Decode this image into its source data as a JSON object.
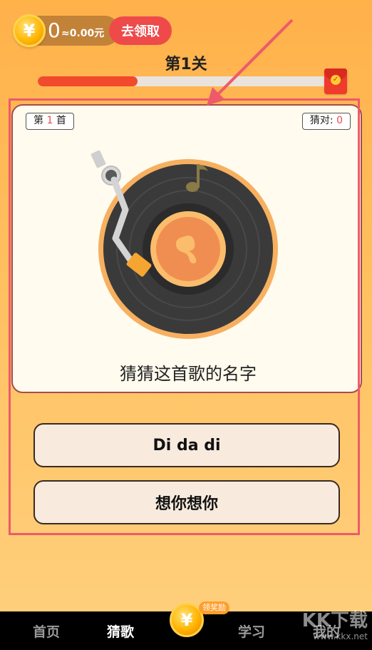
{
  "header": {
    "coin_symbol": "¥",
    "coin_count": "0",
    "money_value": "≈0.00元",
    "claim_label": "去领取"
  },
  "level": {
    "title": "第1关",
    "progress_fraction": 0.34
  },
  "card": {
    "song_prefix": "第",
    "song_number": "1",
    "song_suffix": "首",
    "correct_label": "猜对:",
    "correct_count": "0",
    "question": "猜猜这首歌的名字"
  },
  "options": [
    {
      "label": "Di da di"
    },
    {
      "label": "想你想你"
    }
  ],
  "nav": {
    "home": "首页",
    "guess": "猜歌",
    "center_symbol": "¥",
    "center_badge": "领奖励",
    "learn": "学习",
    "mine": "我的"
  },
  "watermark": {
    "brand": "KK下载",
    "url": "www.kkx.net"
  },
  "colors": {
    "accent_red": "#ee4a4a",
    "progress": "#f24a2c",
    "annotation": "#ee5a6a",
    "background": "#ffb14a"
  }
}
